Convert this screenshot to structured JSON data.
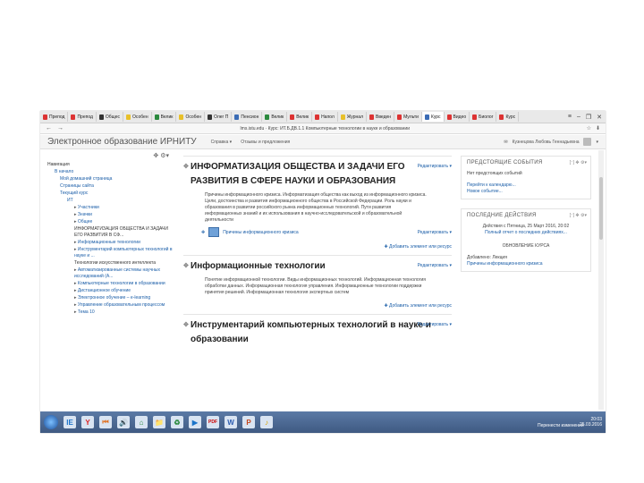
{
  "browser": {
    "tabs": [
      "Препод",
      "Препод",
      "Общес",
      "Особен",
      "Велик",
      "Особен",
      "Олег П",
      "Пенсион",
      "Велик",
      "Велик",
      "Напол",
      "Журнал",
      "Введен",
      "Мульти",
      "Курс",
      "Видео",
      "Биолог",
      "Курс"
    ],
    "url": "lms.istu.edu · Курс: ИТ.Б.ДВ.1.1 Компьютерные технологии в науке и образовании",
    "back": "←",
    "forward": "→",
    "window_controls": [
      "≡",
      "–",
      "❐",
      "✕"
    ]
  },
  "header": {
    "brand": "Электронное образование ИРНИТУ",
    "menu_items": [
      "Справка ▾",
      "Отзывы и предложения"
    ],
    "user_name": "Кузнецова Любовь Геннадьевна"
  },
  "left_nav": {
    "items": [
      {
        "text": "Навигация",
        "level": 0
      },
      {
        "text": "В начало",
        "level": 1
      },
      {
        "text": "Мой домашний страница",
        "level": 2
      },
      {
        "text": "Страницы сайта",
        "level": 2
      },
      {
        "text": "Текущий курс",
        "level": 2
      },
      {
        "text": "ИТ",
        "level": 3
      },
      {
        "text": "Участники",
        "level": 4
      },
      {
        "text": "Значки",
        "level": 4
      },
      {
        "text": "Общее",
        "level": 4
      },
      {
        "text": "ИНФОРМАТИЗАЦИЯ ОБЩЕСТВА И ЗАДАЧИ ЕГО РАЗВИТИЯ В СФ...",
        "level": 5
      },
      {
        "text": "Информационные технологии",
        "level": 4
      },
      {
        "text": "Инструментарий компьютерных технологий в науке и ...",
        "level": 4
      },
      {
        "text": "Технологии искусственного интеллекта",
        "level": 5
      },
      {
        "text": "Автоматизированные системы научных исследований (А...",
        "level": 4
      },
      {
        "text": "Компьютерные технологии в образовании",
        "level": 4
      },
      {
        "text": "Дистанционное обучение",
        "level": 4
      },
      {
        "text": "Электронное обучение – e-learning",
        "level": 4
      },
      {
        "text": "Управление образовательным процессом",
        "level": 4
      },
      {
        "text": "Тема 10",
        "level": 4
      }
    ]
  },
  "topics": [
    {
      "title": "ИНФОРМАТИЗАЦИЯ ОБЩЕСТВА И ЗАДАЧИ ЕГО РАЗВИТИЯ В СФЕРЕ НАУКИ И ОБРАЗОВАНИЯ",
      "edit": "Редактировать ▾",
      "summary": "Причины информационного кризиса. Информатизация общества как выход из информационного кризиса. Цели, достоинства и развития информационного общества в Российской Федерации. Роль науки и образования в развитии российского рынка информационных технологий. Пути развития информационных знаний и их использования в научно-исследовательской и образовательной деятельности",
      "activity": "Причины информационного кризиса",
      "activity_edit": "Редактировать ▾",
      "add": "Добавить элемент или ресурс"
    },
    {
      "title": "Информационные технологии",
      "edit": "Редактировать ▾",
      "summary": "Понятие информационной технологии. Виды информационных технологий. Информационная технология обработки данных. Информационная технология управления. Информационные технологии поддержки принятия решений. Информационная технология экспертных систем",
      "add": "Добавить элемент или ресурс"
    },
    {
      "title": "Инструментарий компьютерных технологий в науке и образовании",
      "edit": "Редактировать ▾"
    }
  ],
  "right": {
    "upcoming": {
      "title": "ПРЕДСТОЯЩИЕ СОБЫТИЯ",
      "empty": "Нет предстоящих событий",
      "link1": "Перейти к календарю...",
      "link2": "Новое событие..."
    },
    "recent": {
      "title": "ПОСЛЕДНИЕ ДЕЙСТВИЯ",
      "since": "Действия с Пятница, 25 Март 2016, 20:02",
      "report": "Полный отчет о последних действиях...",
      "updates_title": "ОБНОВЛЕНИЕ КУРСА",
      "added": "Добавлено: Лекция",
      "added_link": "Причины информационного кризиса"
    }
  },
  "taskbar": {
    "icons": [
      "IE",
      "Y",
      "⏮",
      "🔊",
      "⌂",
      "📁",
      "♻",
      "▶",
      "PDF",
      "W",
      "P",
      "♪"
    ],
    "time": "20:03",
    "date": "25.03.2016",
    "tray_label": "Перенести изменения"
  }
}
